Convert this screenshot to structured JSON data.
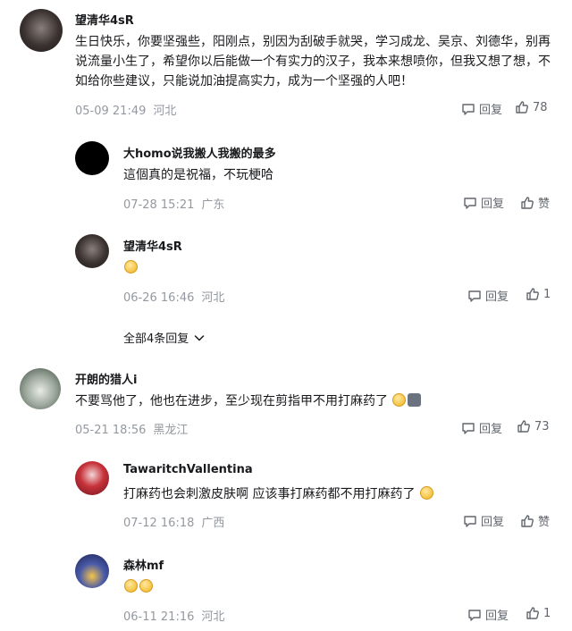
{
  "comments": [
    {
      "user": "望清华4sR",
      "text": "生日快乐，你要坚强些，阳刚点，别因为刮破手就哭，学习成龙、吴京、刘德华，别再说流量小生了，希望你以后能做一个有实力的汉子，我本来想喷你，但我又想了想，不如给你些建议，只能说加油提高实力，成为一个坚强的人吧！",
      "date": "05-09 21:49",
      "location": "河北",
      "reply_label": "回复",
      "likes": "78"
    },
    {
      "user": "大homo说我搬人我搬的最多",
      "text": "這個真的是祝福，不玩梗哈",
      "date": "07-28 15:21",
      "location": "广东",
      "reply_label": "回复",
      "likes": "赞"
    },
    {
      "user": "望清华4sR",
      "text": "",
      "date": "06-26 16:46",
      "location": "河北",
      "reply_label": "回复",
      "likes": "1"
    },
    {
      "user": "开朗的猎人i",
      "text": "不要骂他了，他也在进步，至少现在剪指甲不用打麻药了",
      "date": "05-21 18:56",
      "location": "黑龙江",
      "reply_label": "回复",
      "likes": "73"
    },
    {
      "user": "TawaritchVallentina",
      "text": "打麻药也会刺激皮肤啊 应该事打麻药都不用打麻药了",
      "date": "07-12 16:18",
      "location": "广西",
      "reply_label": "回复",
      "likes": "赞"
    },
    {
      "user": "森林mf",
      "text": "",
      "date": "06-11 21:16",
      "location": "河北",
      "reply_label": "回复",
      "likes": "1"
    }
  ],
  "expand_replies": "全部4条回复",
  "icons": {
    "reply": "reply-icon",
    "like": "thumbs-up-icon",
    "expand": "chevron-down-icon",
    "emoji_smile": "smile-emoji-icon",
    "emoji_cat": "cat-emoji-icon",
    "emoji_laugh_cry": "laugh-cry-emoji-icon"
  }
}
